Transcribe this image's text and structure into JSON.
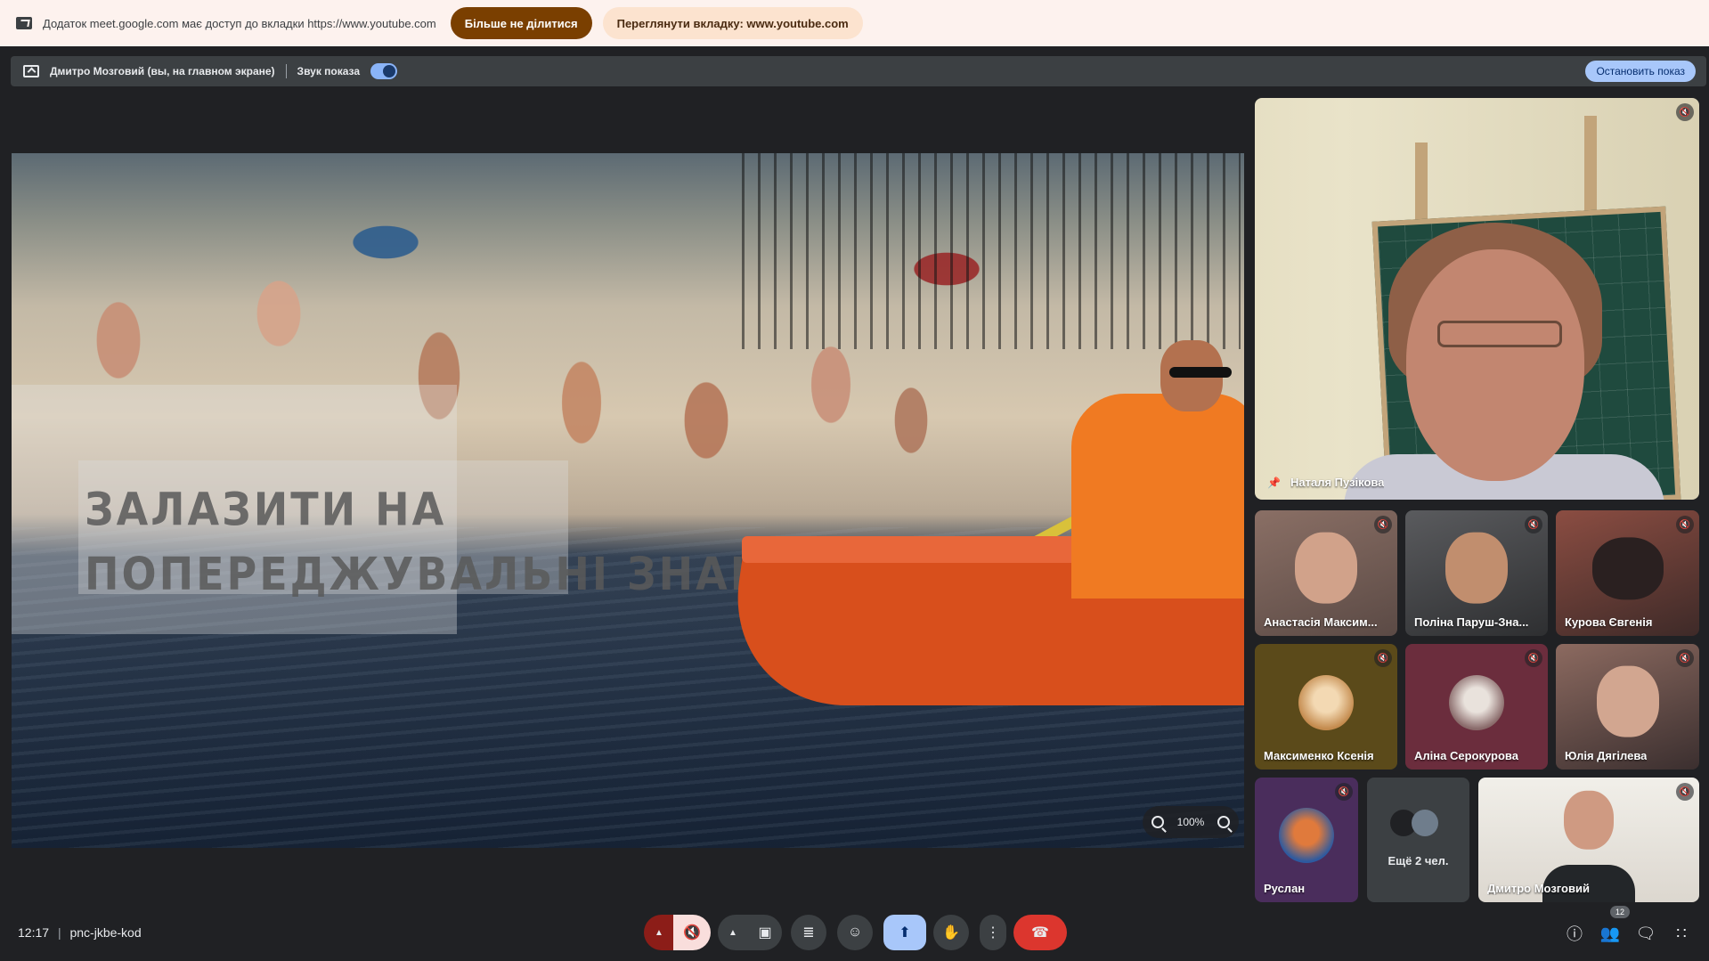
{
  "share_notice": {
    "message": "Додаток meet.google.com має доступ до вкладки https://www.youtube.com",
    "stop_sharing_label": "Більше не ділитися",
    "view_tab_label": "Переглянути вкладку: www.youtube.com"
  },
  "presenting_bar": {
    "presenter": "Дмитро Мозговий (вы, на главном экране)",
    "audio_label": "Звук показа",
    "audio_enabled": true,
    "stop_label": "Остановить показ"
  },
  "presentation": {
    "video_title_line1": "ЗАЛАЗИТИ НА",
    "video_title_line2": "ПОПЕРЕДЖУВАЛЬНІ ЗНАКИ",
    "zoom_level": "100%"
  },
  "participants": {
    "pinned": {
      "name": "Наталя Пузікова"
    },
    "tiles": [
      {
        "name": "Анастасія Максим...",
        "color": "#7c6a62"
      },
      {
        "name": "Поліна Паруш-Зна...",
        "color": "#4b4c4f"
      },
      {
        "name": "Курова Євгенія",
        "color": "#6a3c36"
      },
      {
        "name": "Максименко Ксенія",
        "color": "#5b4a1a"
      },
      {
        "name": "Аліна Серокурова",
        "color": "#6b2d3d"
      },
      {
        "name": "Юлія Дягілева",
        "color": "#5a4a4a"
      },
      {
        "name": "Руслан",
        "color": "#4a2d5c"
      }
    ],
    "more": "Ещё 2 чел.",
    "self": {
      "name": "Дмитро Мозговий"
    }
  },
  "bottom": {
    "time": "12:17",
    "meeting_code": "pnc-jkbe-kod",
    "people_count": "12"
  }
}
